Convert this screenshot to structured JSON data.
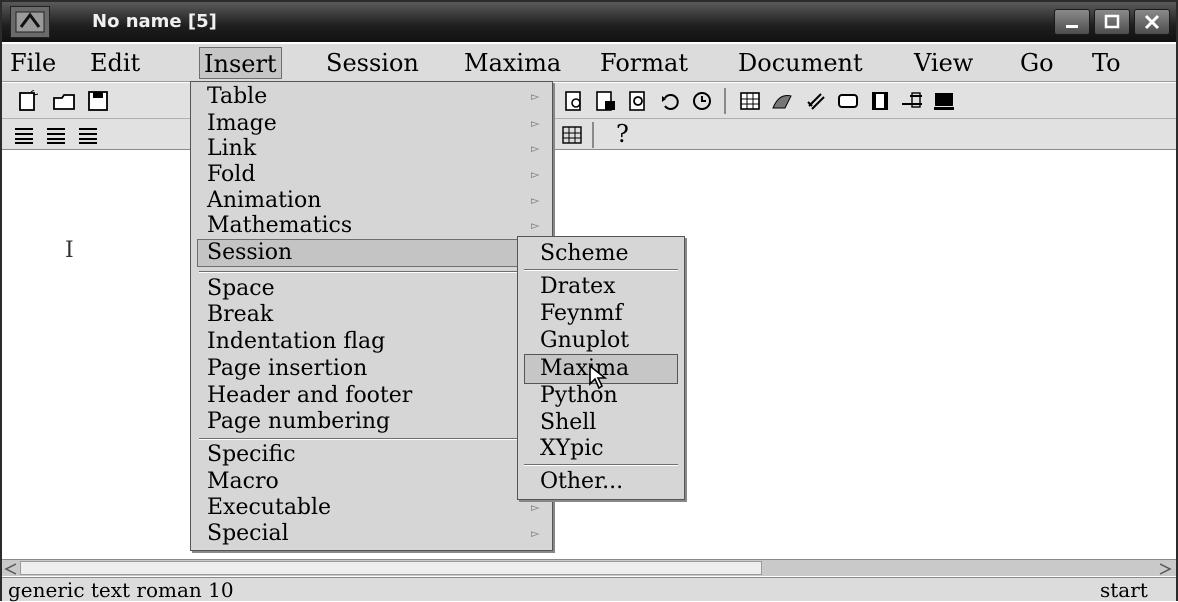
{
  "window": {
    "title": "No name [5]"
  },
  "menubar": {
    "items": [
      "File",
      "Edit",
      "Insert",
      "Session",
      "Maxima",
      "Format",
      "Document",
      "View",
      "Go",
      "To"
    ]
  },
  "insert_menu": {
    "groups": [
      [
        "Table",
        "Image",
        "Link",
        "Fold",
        "Animation",
        "Mathematics",
        "Session"
      ],
      [
        "Space",
        "Break",
        "Indentation flag",
        "Page insertion",
        "Header and footer",
        "Page numbering"
      ],
      [
        "Specific",
        "Macro",
        "Executable",
        "Special"
      ]
    ],
    "highlighted": "Session"
  },
  "session_menu": {
    "items": [
      "Scheme",
      "Dratex",
      "Feynmf",
      "Gnuplot",
      "Maxima",
      "Python",
      "Shell",
      "XYpic",
      "Other..."
    ],
    "highlighted": "Maxima"
  },
  "toolbar2": {
    "help_label": "?"
  },
  "document": {
    "cursor_glyph": "I"
  },
  "statusbar": {
    "left": "generic text roman 10",
    "right": "start"
  },
  "colors": {
    "menu_bg": "#d6d6d6",
    "titlebar": "#1e1e1e",
    "highlight": "#c4c4c4"
  }
}
